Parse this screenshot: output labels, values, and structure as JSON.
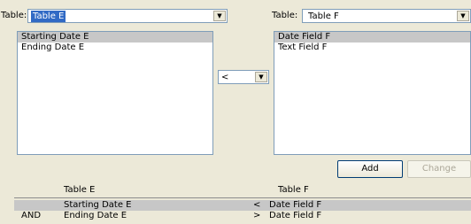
{
  "left_panel": {
    "table_label": "Table:",
    "table_value": "Table E",
    "items": [
      "Starting Date E",
      "Ending Date E"
    ]
  },
  "operator": {
    "value": "<"
  },
  "right_panel": {
    "table_label": "Table:",
    "table_value": "Table F",
    "items": [
      "Date Field F",
      "Text Field F"
    ]
  },
  "buttons": {
    "add_label": "Add",
    "change_label": "Change"
  },
  "conditions": {
    "headers": {
      "left": "Table E",
      "right": "Table F"
    },
    "rows": [
      {
        "conj": "",
        "left": "Starting Date E",
        "op": "<",
        "right": "Date Field F"
      },
      {
        "conj": "AND",
        "left": "Ending Date E",
        "op": ">",
        "right": "Date Field F"
      }
    ]
  }
}
